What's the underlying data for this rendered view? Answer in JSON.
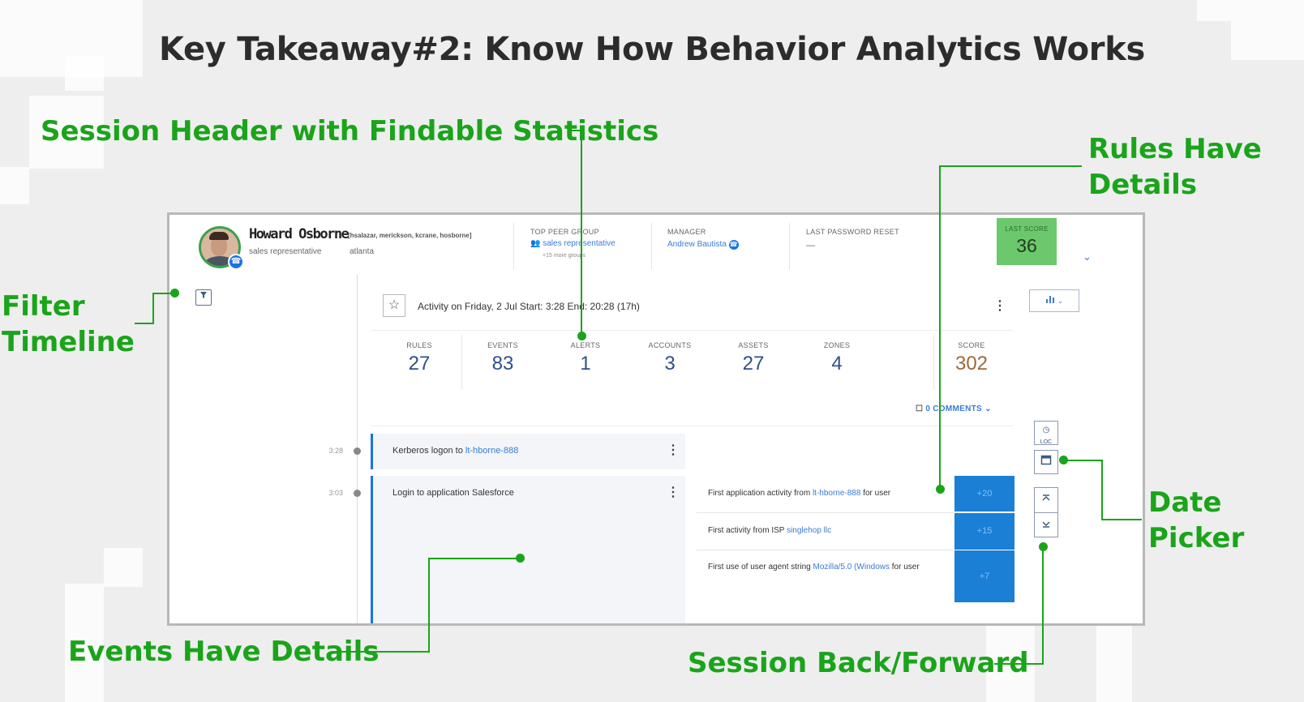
{
  "slide": {
    "title": "Key Takeaway#2: Know How Behavior Analytics Works"
  },
  "callouts": {
    "session_header": "Session Header with Findable Statistics",
    "rules_details_1": "Rules Have",
    "rules_details_2": "Details",
    "filter_timeline_1": "Filter",
    "filter_timeline_2": "Timeline",
    "date_picker_1": "Date",
    "date_picker_2": "Picker",
    "events_details": "Events Have Details",
    "session_back_forward": "Session Back/Forward"
  },
  "colors": {
    "callout_green": "#1aa41a",
    "last_score_green": "#6cc86c",
    "rule_score_blue": "#1b7fd6",
    "event_accent": "#1a73e8"
  },
  "user": {
    "name": "Howard Osborne",
    "aliases": "[hsalazar, merickson, kcrane, hosborne]",
    "role": "sales representative",
    "location": "atlanta"
  },
  "header": {
    "peer_group_label": "TOP PEER GROUP",
    "peer_group_value": "sales representative",
    "peer_group_more": "+15 more groups",
    "manager_label": "MANAGER",
    "manager_value": "Andrew Bautista",
    "password_label": "LAST PASSWORD RESET",
    "password_value": "—",
    "last_score_label": "LAST SCORE",
    "last_score_value": "36"
  },
  "activity": {
    "title": "Activity on Friday, 2 Jul   Start: 3:28 End: 20:28 (17h)",
    "comments": "0 COMMENTS ⌄",
    "stats": [
      {
        "label": "RULES",
        "value": "27"
      },
      {
        "label": "EVENTS",
        "value": "83"
      },
      {
        "label": "ALERTS",
        "value": "1"
      },
      {
        "label": "ACCOUNTS",
        "value": "3"
      },
      {
        "label": "ASSETS",
        "value": "27"
      },
      {
        "label": "ZONES",
        "value": "4"
      },
      {
        "label": "SCORE",
        "value": "302"
      }
    ]
  },
  "events": [
    {
      "time": "3:28",
      "text": "Kerberos logon to ",
      "link": "lt-hborne-888"
    },
    {
      "time": "3:03",
      "text": "Login to application Salesforce",
      "link": ""
    }
  ],
  "rules": [
    {
      "text": "First application activity from ",
      "link": "lt-hborne-888",
      "suffix": " for user",
      "score": "+20"
    },
    {
      "text": "First activity from ISP ",
      "link": "singlehop llc",
      "suffix": "",
      "score": "+15"
    },
    {
      "text": "First use of user agent string ",
      "link": "Mozilla/5.0 (Windows",
      "suffix": " for user",
      "score": "+7"
    }
  ],
  "icons": {
    "filter": "filter-icon",
    "star": "star-icon",
    "chart": "bar-chart-icon",
    "loc": "loc-icon",
    "calendar": "calendar-icon",
    "back": "chevrons-up-icon",
    "forward": "chevrons-down-icon",
    "more": "kebab-icon",
    "expand": "chevron-down-icon"
  },
  "loc_label": "LOC"
}
